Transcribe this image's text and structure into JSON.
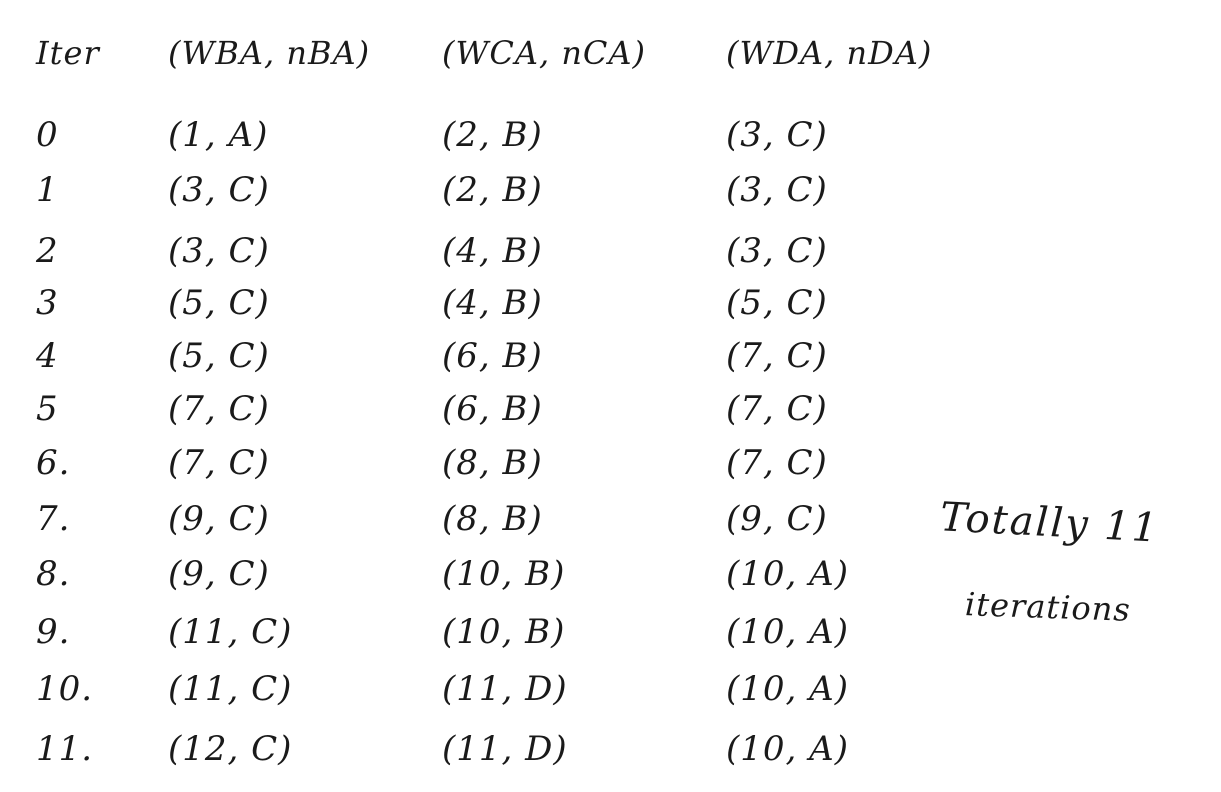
{
  "table": {
    "headers": {
      "iter": "Iter",
      "ba": "(WBA, nBA)",
      "ca": "(WCA, nCA)",
      "da": "(WDA, nDA)"
    },
    "rows": [
      {
        "iter": "0",
        "ba": "(1, A)",
        "ca": "(2, B)",
        "da": "(3, C)"
      },
      {
        "iter": "1",
        "ba": "(3, C)",
        "ca": "(2, B)",
        "da": "(3, C)"
      },
      {
        "iter": "2",
        "ba": "(3, C)",
        "ca": "(4, B)",
        "da": "(3, C)"
      },
      {
        "iter": "3",
        "ba": "(5, C)",
        "ca": "(4, B)",
        "da": "(5, C)"
      },
      {
        "iter": "4",
        "ba": "(5, C)",
        "ca": "(6, B)",
        "da": "(7, C)"
      },
      {
        "iter": "5",
        "ba": "(7, C)",
        "ca": "(6, B)",
        "da": "(7, C)"
      },
      {
        "iter": "6.",
        "ba": "(7, C)",
        "ca": "(8, B)",
        "da": "(7, C)"
      },
      {
        "iter": "7.",
        "ba": "(9, C)",
        "ca": "(8, B)",
        "da": "(9, C)"
      },
      {
        "iter": "8.",
        "ba": "(9, C)",
        "ca": "(10, B)",
        "da": "(10, A)"
      },
      {
        "iter": "9.",
        "ba": "(11, C)",
        "ca": "(10, B)",
        "da": "(10, A)"
      },
      {
        "iter": "10.",
        "ba": "(11, C)",
        "ca": "(11, D)",
        "da": "(10, A)"
      },
      {
        "iter": "11.",
        "ba": "(12, C)",
        "ca": "(11, D)",
        "da": "(10, A)"
      }
    ]
  },
  "notes": {
    "line1": "Totally 11",
    "line2": "iterations"
  }
}
